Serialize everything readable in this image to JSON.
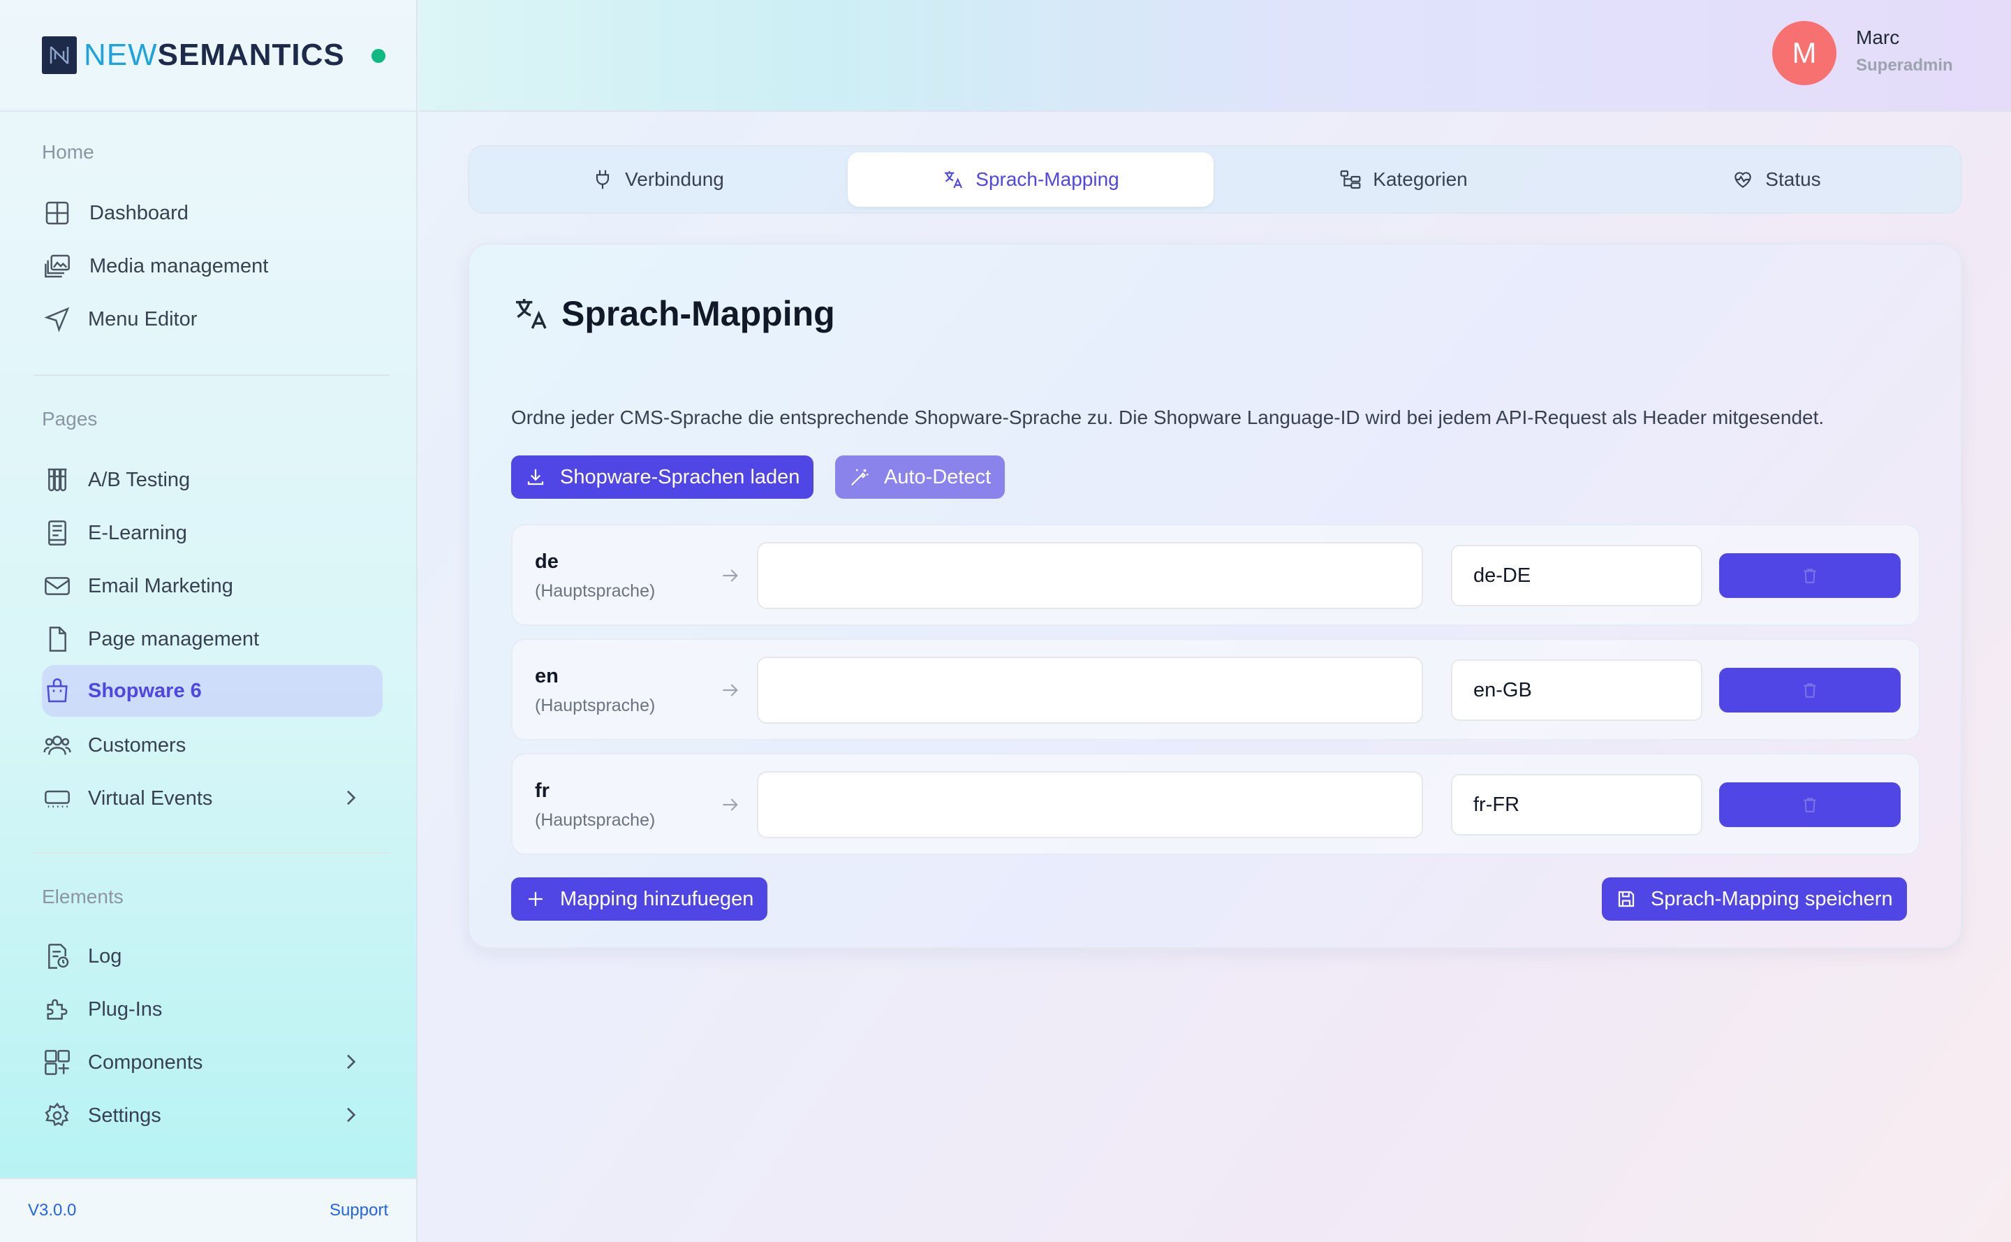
{
  "brand": {
    "part1": "NEW",
    "part2": "SEMANTICS",
    "status_color": "#10b981"
  },
  "sidebar": {
    "sections": [
      {
        "title": "Home"
      },
      {
        "title": "Pages"
      },
      {
        "title": "Elements"
      }
    ],
    "home_items": [
      {
        "label": "Dashboard",
        "icon": "grid-icon"
      },
      {
        "label": "Media management",
        "icon": "images-icon"
      },
      {
        "label": "Menu Editor",
        "icon": "navigation-arrow-icon"
      }
    ],
    "page_items": [
      {
        "label": "A/B Testing",
        "icon": "test-tubes-icon"
      },
      {
        "label": "E-Learning",
        "icon": "book-icon"
      },
      {
        "label": "Email Marketing",
        "icon": "mail-icon"
      },
      {
        "label": "Page management",
        "icon": "file-icon"
      },
      {
        "label": "Shopware 6",
        "icon": "shopping-bag-icon",
        "active": true
      },
      {
        "label": "Customers",
        "icon": "users-icon"
      },
      {
        "label": "Virtual Events",
        "icon": "event-icon",
        "has_submenu": true
      }
    ],
    "element_items": [
      {
        "label": "Log",
        "icon": "log-file-icon"
      },
      {
        "label": "Plug-Ins",
        "icon": "puzzle-icon"
      },
      {
        "label": "Components",
        "icon": "components-icon",
        "has_submenu": true
      },
      {
        "label": "Settings",
        "icon": "gear-icon",
        "has_submenu": true
      }
    ],
    "footer": {
      "version": "V3.0.0",
      "support": "Support"
    }
  },
  "user": {
    "initial": "M",
    "name": "Marc",
    "role": "Superadmin",
    "avatar_color": "#f87171"
  },
  "tabs": [
    {
      "label": "Verbindung",
      "icon": "plug-icon"
    },
    {
      "label": "Sprach-Mapping",
      "icon": "translate-icon",
      "active": true
    },
    {
      "label": "Kategorien",
      "icon": "folder-tree-icon"
    },
    {
      "label": "Status",
      "icon": "heart-pulse-icon"
    }
  ],
  "card": {
    "title": "Sprach-Mapping",
    "description": "Ordne jeder CMS-Sprache die entsprechende Shopware-Sprache zu. Die Shopware Language-ID wird bei jedem API-Request als Header mitgesendet.",
    "load_button": "Shopware-Sprachen laden",
    "autodetect_button": "Auto-Detect",
    "add_button": "Mapping hinzufuegen",
    "save_button": "Sprach-Mapping speichern",
    "accent_color": "#4f46e5",
    "mappings": [
      {
        "code": "de",
        "sub": "(Hauptsprache)",
        "value": "",
        "locale": "de-DE"
      },
      {
        "code": "en",
        "sub": "(Hauptsprache)",
        "value": "",
        "locale": "en-GB"
      },
      {
        "code": "fr",
        "sub": "(Hauptsprache)",
        "value": "",
        "locale": "fr-FR"
      }
    ]
  }
}
